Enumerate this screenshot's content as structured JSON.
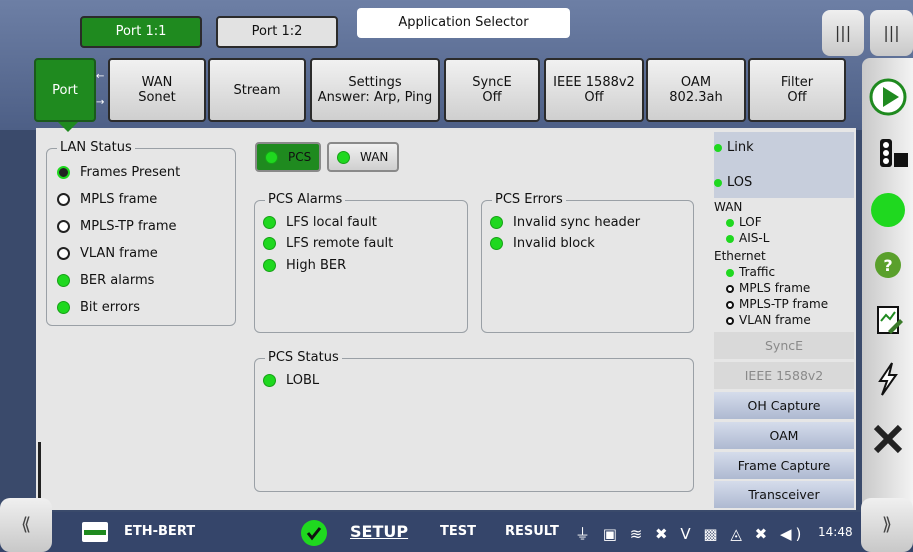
{
  "port_tabs": {
    "active": "Port 1:1",
    "inactive": "Port 1:2"
  },
  "app_title": "Application Selector",
  "nav_tabs": [
    {
      "line1": "Port",
      "line2": ""
    },
    {
      "line1": "WAN",
      "line2": "Sonet"
    },
    {
      "line1": "Stream",
      "line2": ""
    },
    {
      "line1": "Settings",
      "line2": "Answer: Arp, Ping"
    },
    {
      "line1": "SyncE",
      "line2": "Off"
    },
    {
      "line1": "IEEE 1588v2",
      "line2": "Off"
    },
    {
      "line1": "OAM",
      "line2": "802.3ah"
    },
    {
      "line1": "Filter",
      "line2": "Off"
    }
  ],
  "lan_status": {
    "title": "LAN Status",
    "items": [
      {
        "label": "Frames Present",
        "state": "off-green"
      },
      {
        "label": "MPLS frame",
        "state": "off"
      },
      {
        "label": "MPLS-TP frame",
        "state": "off"
      },
      {
        "label": "VLAN frame",
        "state": "off"
      },
      {
        "label": "BER alarms",
        "state": "green"
      },
      {
        "label": "Bit errors",
        "state": "green"
      }
    ]
  },
  "toggles": {
    "pcs": "PCS",
    "wan": "WAN"
  },
  "pcs_alarms": {
    "title": "PCS Alarms",
    "items": [
      "LFS local fault",
      "LFS remote fault",
      "High BER"
    ]
  },
  "pcs_errors": {
    "title": "PCS Errors",
    "items": [
      "Invalid sync header",
      "Invalid block"
    ]
  },
  "pcs_status": {
    "title": "PCS Status",
    "items": [
      "LOBL"
    ]
  },
  "right_panel": {
    "link": "Link",
    "los": "LOS",
    "wan_title": "WAN",
    "wan_items": [
      "LOF",
      "AIS-L"
    ],
    "eth_title": "Ethernet",
    "eth_items": [
      {
        "label": "Traffic",
        "state": "green"
      },
      {
        "label": "MPLS frame",
        "state": "off"
      },
      {
        "label": "MPLS-TP frame",
        "state": "off"
      },
      {
        "label": "VLAN frame",
        "state": "off"
      }
    ],
    "buttons": [
      {
        "label": "SyncE",
        "dim": true
      },
      {
        "label": "IEEE 1588v2",
        "dim": true
      },
      {
        "label": "OH Capture",
        "dim": false
      },
      {
        "label": "OAM",
        "dim": false
      },
      {
        "label": "Frame Capture",
        "dim": false
      },
      {
        "label": "Transceiver",
        "dim": false
      }
    ]
  },
  "bottom_bar": {
    "app_name": "ETH-BERT",
    "setup": "SETUP",
    "test": "TEST",
    "result": "RESULT",
    "time": "14:48"
  },
  "colors": {
    "accent_green": "#1f8a1f",
    "led_green": "#1fd81f"
  }
}
